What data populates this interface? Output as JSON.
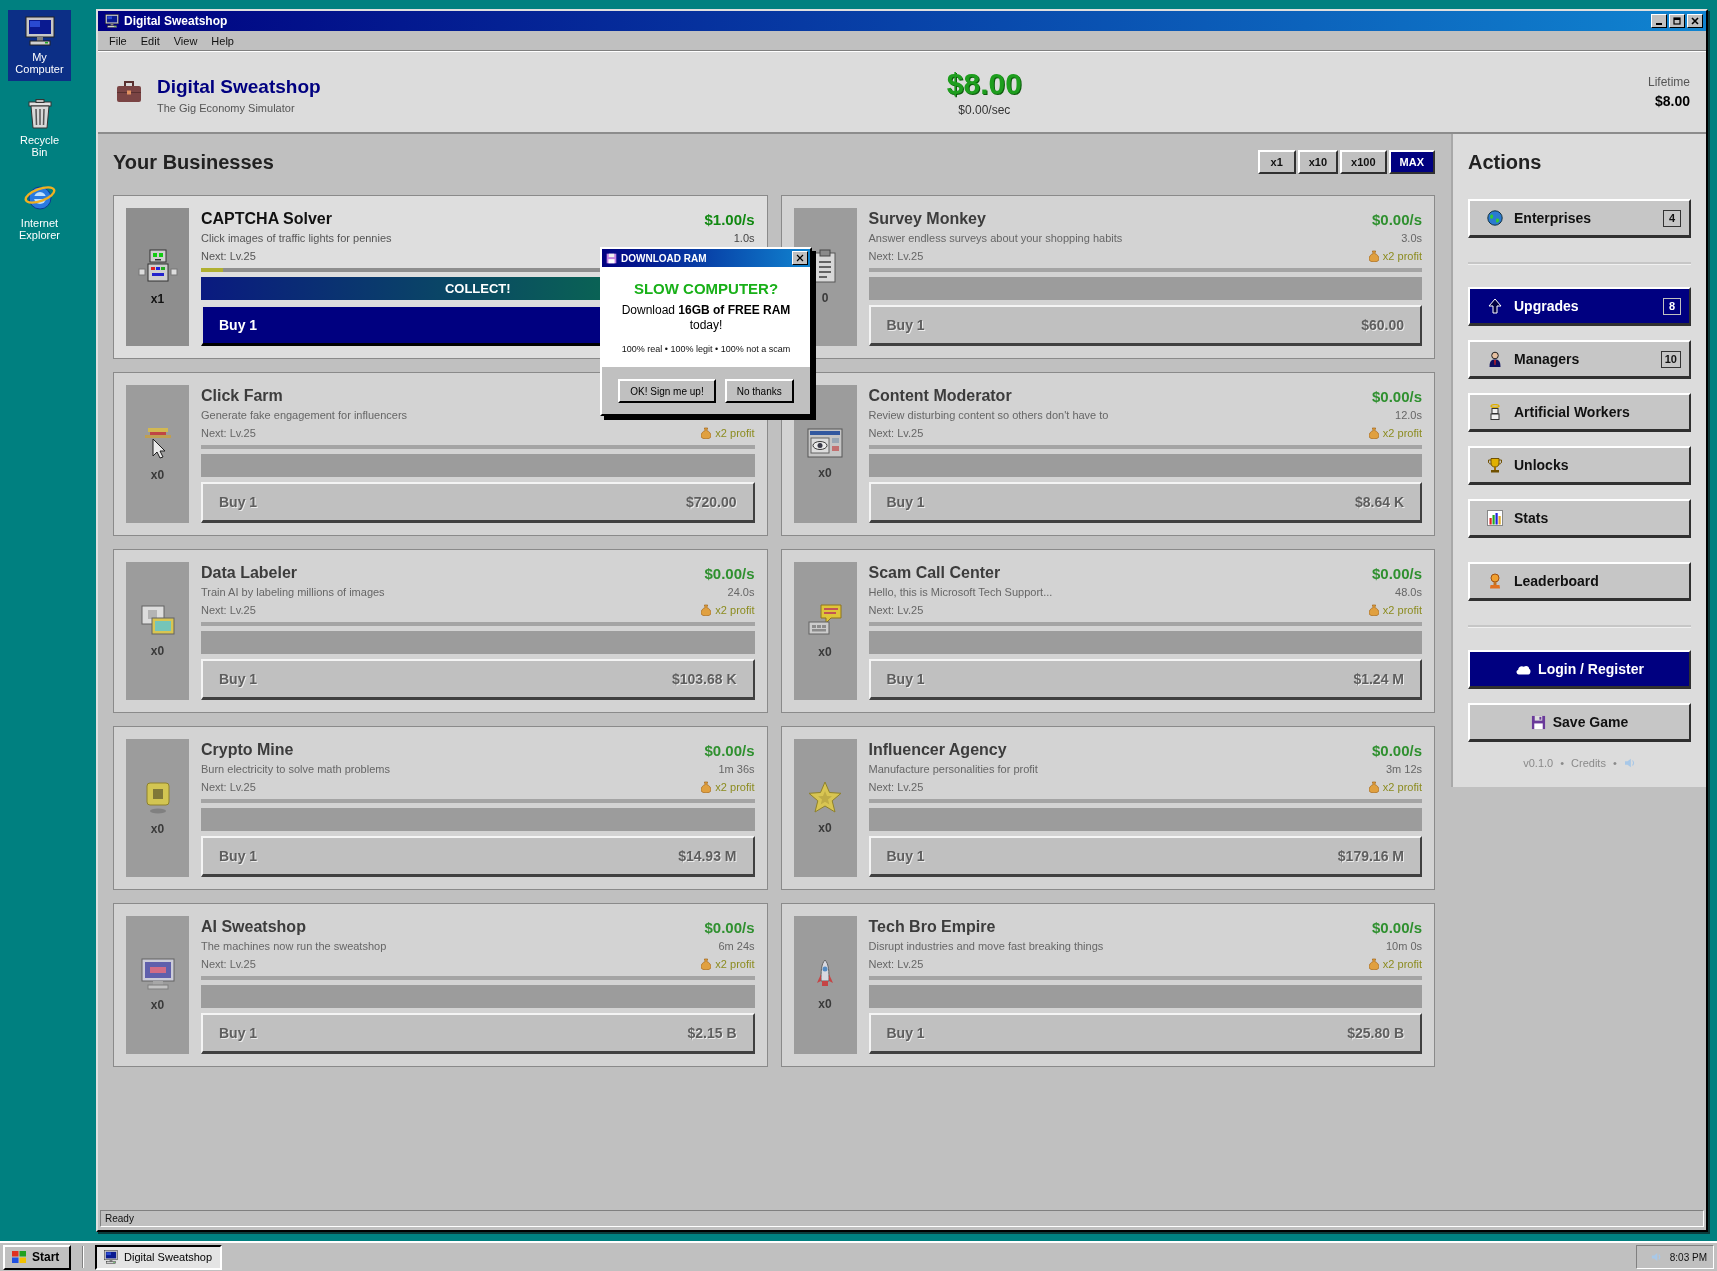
{
  "desktop_icons": [
    {
      "label": "My Computer",
      "selected": true
    },
    {
      "label": "Recycle Bin",
      "selected": false
    },
    {
      "label": "Internet Explorer",
      "selected": false
    }
  ],
  "window": {
    "title": "Digital Sweatshop"
  },
  "menu": [
    "File",
    "Edit",
    "View",
    "Help"
  ],
  "header": {
    "title": "Digital Sweatshop",
    "subtitle": "The Gig Economy Simulator",
    "balance": "$8.00",
    "rate": "$0.00/sec",
    "lifetime_label": "Lifetime",
    "lifetime_value": "$8.00"
  },
  "businesses": {
    "heading": "Your Businesses",
    "multipliers": [
      {
        "label": "x1",
        "selected": false
      },
      {
        "label": "x10",
        "selected": false
      },
      {
        "label": "x100",
        "selected": false
      },
      {
        "label": "MAX",
        "selected": true
      }
    ],
    "items": [
      {
        "name": "CAPTCHA Solver",
        "description": "Click images of traffic lights for pennies",
        "next": "Next: Lv.25",
        "rate": "$1.00/s",
        "cycle": "1.0s",
        "owned": "x1",
        "level": 0.04,
        "collect": "COLLECT!",
        "buy": "Buy 1",
        "disabled": false
      },
      {
        "name": "Survey Monkey",
        "description": "Answer endless surveys about your shopping habits",
        "next": "Next: Lv.25",
        "rate": "$0.00/s",
        "cycle": "3.0s",
        "bonus": "x2 profit",
        "owned": "0",
        "buy": "Buy 1",
        "cost": "$60.00",
        "disabled": true
      },
      {
        "name": "Click Farm",
        "description": "Generate fake engagement for influencers",
        "next": "Next: Lv.25",
        "bonus": "x2 profit",
        "owned": "x0",
        "buy": "Buy 1",
        "cost": "$720.00",
        "disabled": true
      },
      {
        "name": "Content Moderator",
        "description": "Review disturbing content so others don't have to",
        "next": "Next: Lv.25",
        "rate": "$0.00/s",
        "cycle": "12.0s",
        "bonus": "x2 profit",
        "owned": "x0",
        "buy": "Buy 1",
        "cost": "$8.64 K",
        "disabled": true
      },
      {
        "name": "Data Labeler",
        "description": "Train AI by labeling millions of images",
        "next": "Next: Lv.25",
        "rate": "$0.00/s",
        "cycle": "24.0s",
        "bonus": "x2 profit",
        "owned": "x0",
        "buy": "Buy 1",
        "cost": "$103.68 K",
        "disabled": true
      },
      {
        "name": "Scam Call Center",
        "description": "Hello, this is Microsoft Tech Support...",
        "next": "Next: Lv.25",
        "rate": "$0.00/s",
        "cycle": "48.0s",
        "bonus": "x2 profit",
        "owned": "x0",
        "buy": "Buy 1",
        "cost": "$1.24 M",
        "disabled": true
      },
      {
        "name": "Crypto Mine",
        "description": "Burn electricity to solve math problems",
        "next": "Next: Lv.25",
        "rate": "$0.00/s",
        "cycle": "1m 36s",
        "bonus": "x2 profit",
        "owned": "x0",
        "buy": "Buy 1",
        "cost": "$14.93 M",
        "disabled": true
      },
      {
        "name": "Influencer Agency",
        "description": "Manufacture personalities for profit",
        "next": "Next: Lv.25",
        "rate": "$0.00/s",
        "cycle": "3m 12s",
        "bonus": "x2 profit",
        "owned": "x0",
        "buy": "Buy 1",
        "cost": "$179.16 M",
        "disabled": true
      },
      {
        "name": "AI Sweatshop",
        "description": "The machines now run the sweatshop",
        "next": "Next: Lv.25",
        "rate": "$0.00/s",
        "cycle": "6m 24s",
        "bonus": "x2 profit",
        "owned": "x0",
        "buy": "Buy 1",
        "cost": "$2.15 B",
        "disabled": true
      },
      {
        "name": "Tech Bro Empire",
        "description": "Disrupt industries and move fast breaking things",
        "next": "Next: Lv.25",
        "rate": "$0.00/s",
        "cycle": "10m 0s",
        "bonus": "x2 profit",
        "owned": "x0",
        "buy": "Buy 1",
        "cost": "$25.80 B",
        "disabled": true
      }
    ]
  },
  "actions": {
    "heading": "Actions",
    "sections": [
      {
        "divider": false,
        "items": [
          {
            "label": "Enterprises",
            "badge": "4",
            "selected": false
          }
        ]
      },
      {
        "divider": true,
        "items": [
          {
            "label": "Upgrades",
            "badge": "8",
            "selected": true
          },
          {
            "label": "Managers",
            "badge": "10",
            "selected": false
          },
          {
            "label": "Artificial Workers",
            "selected": false
          },
          {
            "label": "Unlocks",
            "selected": false
          },
          {
            "label": "Stats",
            "selected": false
          }
        ]
      },
      {
        "divider": false,
        "items": [
          {
            "label": "Leaderboard",
            "selected": false
          }
        ]
      }
    ],
    "account": {
      "divider": true,
      "buttons": [
        {
          "label": "Login / Register",
          "kind": "primary"
        },
        {
          "label": "Save Game",
          "kind": "secondary"
        }
      ]
    },
    "footer": [
      {
        "kind": "text",
        "text": "v0.1.0"
      },
      {
        "kind": "separator",
        "text": "•"
      },
      {
        "kind": "link",
        "text": "Credits"
      },
      {
        "kind": "separator",
        "text": "•"
      },
      {
        "kind": "sound"
      }
    ]
  },
  "popup": {
    "title": "DOWNLOAD RAM",
    "headline": "SLOW COMPUTER?",
    "body": "Download **16GB of FREE RAM** today!",
    "fine_print": "100% real • 100% legit • 100% not a scam",
    "buttons": [
      "OK! Sign me up!",
      "No thanks"
    ]
  },
  "status_bar": {
    "text": "Ready"
  },
  "taskbar": {
    "start": "Start",
    "tasks": [
      {
        "label": "Digital Sweatshop",
        "selected": true
      }
    ],
    "clock": "8:03 PM"
  }
}
